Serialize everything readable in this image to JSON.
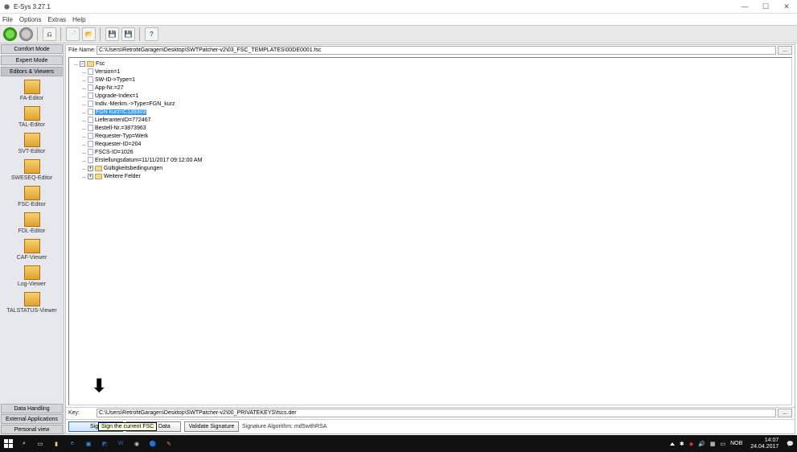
{
  "window": {
    "title": "E-Sys 3.27.1",
    "min": "—",
    "max": "☐",
    "close": "✕"
  },
  "menu": {
    "file": "File",
    "options": "Options",
    "extras": "Extras",
    "help": "Help"
  },
  "sidebar": {
    "tabs": {
      "comfort": "Comfort Mode",
      "expert": "Expert Mode",
      "editors": "Editors & Viewers"
    },
    "items": [
      {
        "label": "FA-Editor"
      },
      {
        "label": "TAL-Editor"
      },
      {
        "label": "SVT-Editor"
      },
      {
        "label": "SWESEQ-Editor"
      },
      {
        "label": "FSC-Editor"
      },
      {
        "label": "FDL-Editor"
      },
      {
        "label": "CAF-Viewer"
      },
      {
        "label": "Log-Viewer"
      },
      {
        "label": "TALSTATUS-Viewer"
      }
    ],
    "bottom": {
      "data": "Data Handling",
      "ext": "External Applications",
      "personal": "Personal view"
    }
  },
  "fields": {
    "file_label": "File Name:",
    "file_value": "C:\\Users\\RetrofitGaragen\\Desktop\\SWTPatcher-v2\\03_FSC_TEMPLATES\\00DE0001.fsc",
    "key_label": "Key:",
    "key_value": "C:\\Users\\RetrofitGaragen\\Desktop\\SWTPatcher-v2\\00_PRIVATEKEYS\\fscs.der",
    "dots": "..."
  },
  "tree": {
    "root": "Fsc",
    "items": [
      "Version=1",
      "SW-ID->Type=1",
      "App-Nr.=27",
      "Upgrade-Index=1",
      "Indiv.-Merkm.->Type=FGN_kurz",
      "FGN kurz=C139303",
      "LieferantenID=772467",
      "Bestell-Nr.=3873963",
      "Requester-Typ=Werk",
      "Requester-ID=204",
      "FSCS-ID=1026",
      "Erstellungsdatum=11/11/2017 09:12:00 AM"
    ],
    "sel_index": 5,
    "folders": [
      "Gültigkeitsbedingungen",
      "Weitere Felder"
    ]
  },
  "actions": {
    "sign": "Sign",
    "validate_data": "Validate Data",
    "validate_sig": "Validate Signature",
    "sig_label": "Signature Algorithm: md5withRSA",
    "tooltip": "Sign the current FSC"
  },
  "taskbar": {
    "lang": "NOB",
    "time": "14:07",
    "date": "24.04.2017"
  }
}
